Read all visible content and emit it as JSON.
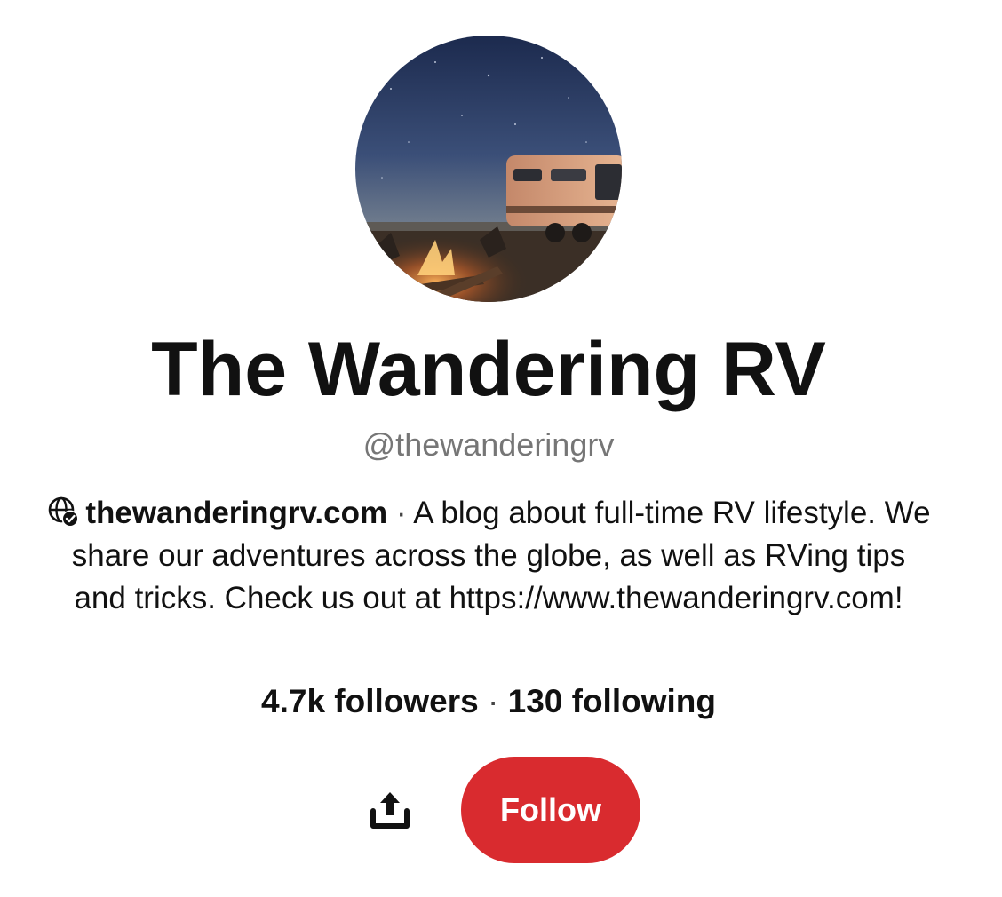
{
  "profile": {
    "display_name": "The Wandering RV",
    "handle": "@thewanderingrv",
    "website": "thewanderingrv.com",
    "separator": " · ",
    "bio": "A blog about full-time RV lifestyle. We share our adventures across the globe, as well as RVing tips and tricks. Check us out at https://www.thewanderingrv.com!",
    "avatar_icon": "profile-photo-rv-campfire-night"
  },
  "stats": {
    "followers": "4.7k followers",
    "separator": " · ",
    "following": "130 following"
  },
  "actions": {
    "share_icon": "share-icon",
    "follow_label": "Follow"
  },
  "colors": {
    "follow_button": "#d92b2f",
    "handle_text": "#767676",
    "primary_text": "#111111"
  }
}
